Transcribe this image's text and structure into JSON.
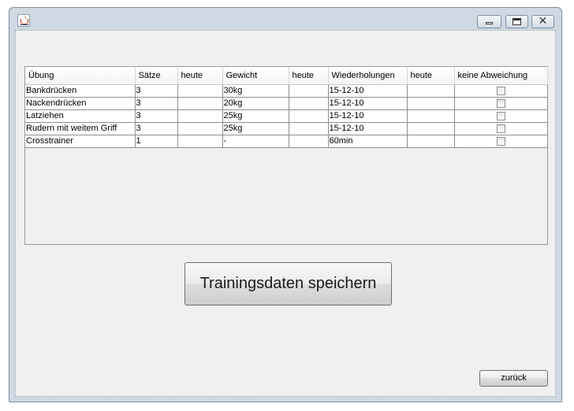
{
  "table": {
    "columns": [
      "Übung",
      "Sätze",
      "heute",
      "Gewicht",
      "heute",
      "Wiederholungen",
      "heute",
      "keine Abweichung"
    ],
    "rows": [
      {
        "uebung": "Bankdrücken",
        "saetze": "3",
        "heute1": "",
        "gewicht": "30kg",
        "heute2": "",
        "wiederholungen": "15-12-10",
        "heute3": "",
        "keine_abweichung": false
      },
      {
        "uebung": "Nackendrücken",
        "saetze": "3",
        "heute1": "",
        "gewicht": "20kg",
        "heute2": "",
        "wiederholungen": "15-12-10",
        "heute3": "",
        "keine_abweichung": false
      },
      {
        "uebung": "Latziehen",
        "saetze": "3",
        "heute1": "",
        "gewicht": "25kg",
        "heute2": "",
        "wiederholungen": "15-12-10",
        "heute3": "",
        "keine_abweichung": false
      },
      {
        "uebung": "Rudern mit weitem Griff",
        "saetze": "3",
        "heute1": "",
        "gewicht": "25kg",
        "heute2": "",
        "wiederholungen": "15-12-10",
        "heute3": "",
        "keine_abweichung": false
      },
      {
        "uebung": "Crosstrainer",
        "saetze": "1",
        "heute1": "",
        "gewicht": "-",
        "heute2": "",
        "wiederholungen": "60min",
        "heute3": "",
        "keine_abweichung": false
      }
    ]
  },
  "buttons": {
    "save": "Trainingsdaten speichern",
    "back": "zurück"
  },
  "window": {
    "icon": "java-cup-icon",
    "controls": {
      "minimize_icon": "minimize-icon",
      "maximize_icon": "maximize-icon",
      "close_icon": "close-icon",
      "close_glyph": "✕"
    }
  }
}
